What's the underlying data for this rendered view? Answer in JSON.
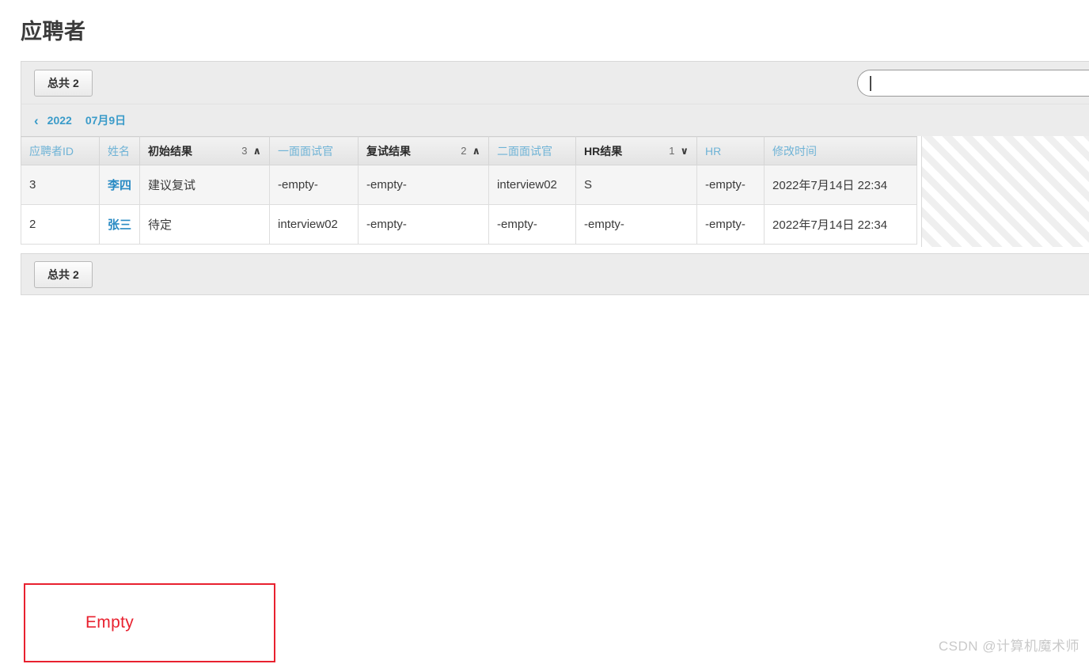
{
  "page": {
    "title": "应聘者"
  },
  "toolbar_top": {
    "count_button": {
      "label": "总共",
      "value": "2"
    },
    "search": {
      "value": "",
      "placeholder": ""
    }
  },
  "date_nav": {
    "prev_icon": "chevron-left-icon",
    "prev_glyph": "‹",
    "year": "2022",
    "date": "07月9日"
  },
  "table": {
    "columns": [
      {
        "label": "应聘者ID",
        "sorted": false,
        "sort_index": "",
        "sort_arrow": ""
      },
      {
        "label": "姓名",
        "sorted": false,
        "sort_index": "",
        "sort_arrow": ""
      },
      {
        "label": "初始结果",
        "sorted": true,
        "sort_index": "3",
        "sort_arrow": "∧"
      },
      {
        "label": "一面面试官",
        "sorted": false,
        "sort_index": "",
        "sort_arrow": ""
      },
      {
        "label": "复试结果",
        "sorted": true,
        "sort_index": "2",
        "sort_arrow": "∧"
      },
      {
        "label": "二面面试官",
        "sorted": false,
        "sort_index": "",
        "sort_arrow": ""
      },
      {
        "label": "HR结果",
        "sorted": true,
        "sort_index": "1",
        "sort_arrow": "∨"
      },
      {
        "label": "HR",
        "sorted": false,
        "sort_index": "",
        "sort_arrow": ""
      },
      {
        "label": "修改时间",
        "sorted": false,
        "sort_index": "",
        "sort_arrow": ""
      }
    ],
    "rows": [
      {
        "id": "3",
        "name": "李四",
        "initial_result": "建议复试",
        "interviewer1": "-empty-",
        "second_result": "-empty-",
        "interviewer2": "interview02",
        "hr_result": "S",
        "hr": "-empty-",
        "modified_time": "2022年7月14日 22:34"
      },
      {
        "id": "2",
        "name": "张三",
        "initial_result": "待定",
        "interviewer1": "interview02",
        "second_result": "-empty-",
        "interviewer2": "-empty-",
        "hr_result": "-empty-",
        "hr": "-empty-",
        "modified_time": "2022年7月14日 22:34"
      }
    ]
  },
  "toolbar_bottom": {
    "count_button": {
      "label": "总共",
      "value": "2"
    }
  },
  "annotation": {
    "empty_label": "Empty"
  },
  "watermark": {
    "text": "CSDN @计算机魔术师"
  },
  "colors": {
    "link_blue": "#2a8bc4",
    "header_link_blue": "#6fb3d6",
    "annotation_red": "#e8212f",
    "toolbar_bg": "#ececec"
  }
}
